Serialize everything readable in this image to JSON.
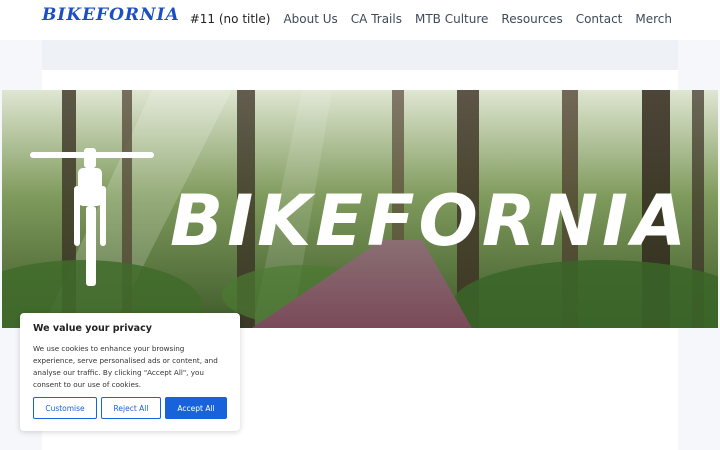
{
  "header": {
    "logo": "BIKEFORNIA",
    "nav": [
      "#11 (no title)",
      "About Us",
      "CA Trails",
      "MTB Culture",
      "Resources",
      "Contact",
      "Merch"
    ]
  },
  "hero": {
    "wordmark": "BIKEFORNIA"
  },
  "cookie": {
    "title": "We value your privacy",
    "text": "We use cookies to enhance your browsing experience, serve personalised ads or content, and analyse our traffic. By clicking \"Accept All\", you consent to our use of cookies.",
    "customise": "Customise",
    "reject": "Reject All",
    "accept": "Accept All"
  },
  "colors": {
    "brand": "#1d4fc4",
    "button": "#1863dc"
  }
}
